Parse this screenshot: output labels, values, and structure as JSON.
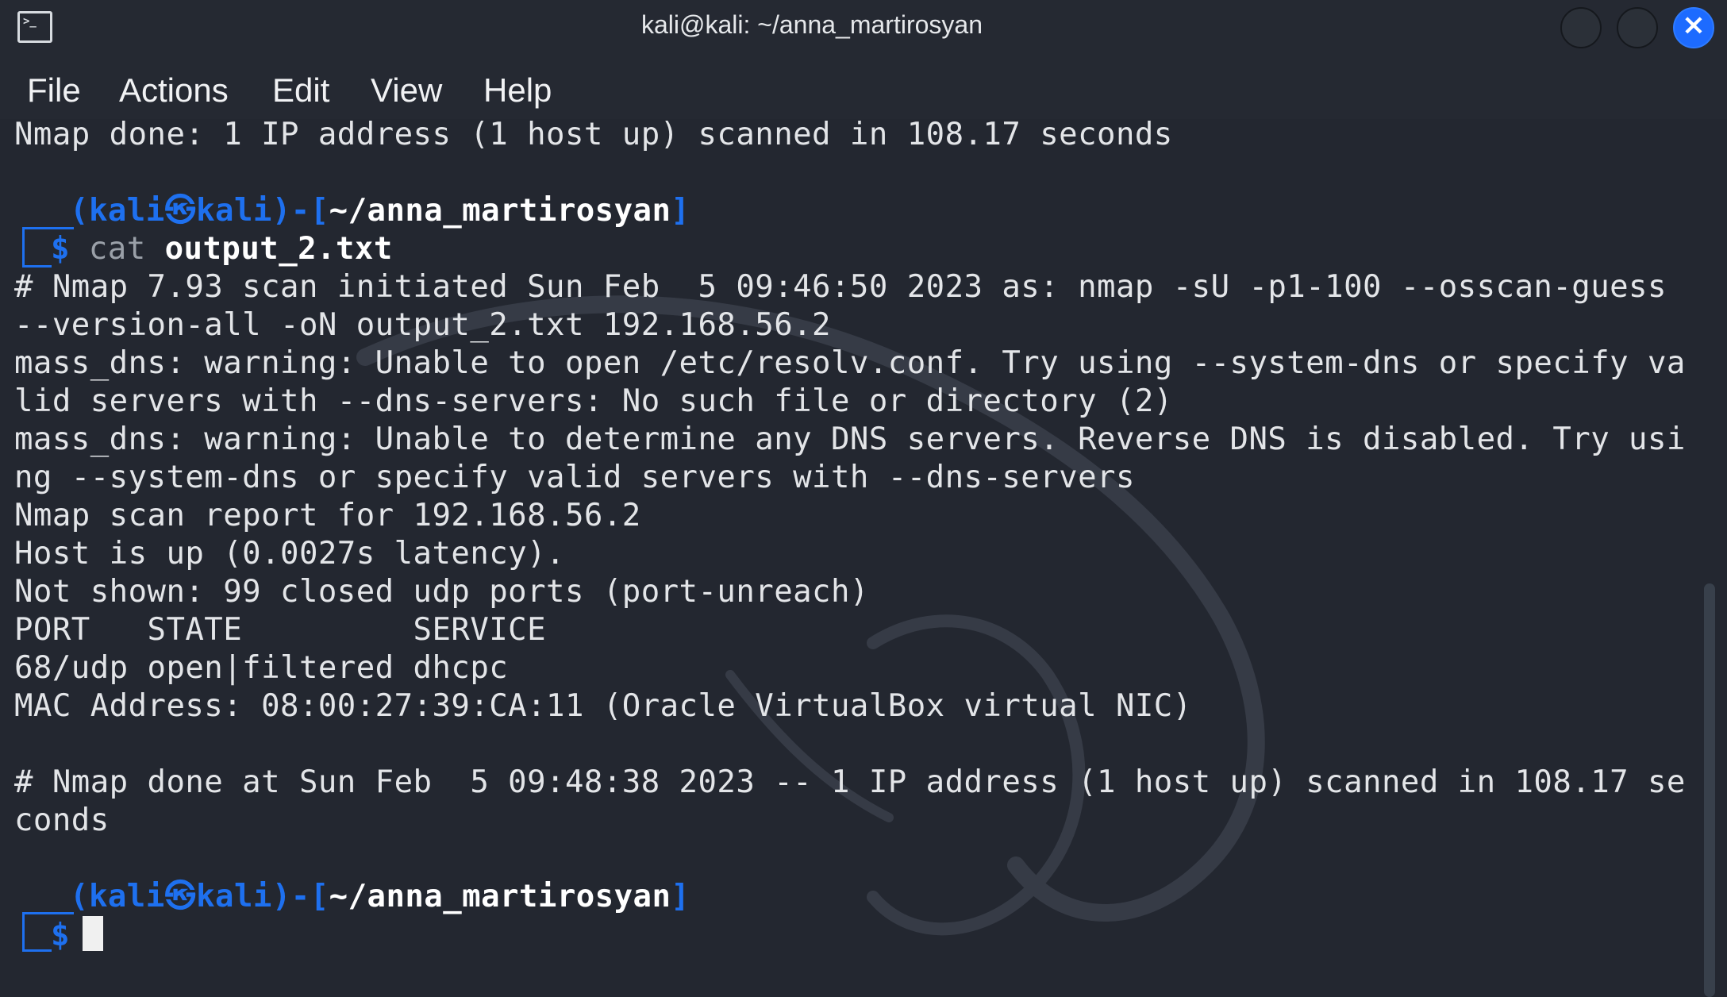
{
  "window": {
    "title": "kali@kali: ~/anna_martirosyan"
  },
  "menu": {
    "file": "File",
    "actions": "Actions",
    "edit": "Edit",
    "view": "View",
    "help": "Help"
  },
  "terminal": {
    "line_done": "Nmap done: 1 IP address (1 host up) scanned in 108.17 seconds",
    "prompt1": {
      "open": "(",
      "user": "kali",
      "at": "㉿",
      "host": "kali",
      "mid": ")-[",
      "path": "~/anna_martirosyan",
      "close": "]",
      "dollar": "$",
      "cmd": "cat",
      "arg": "output_2.txt"
    },
    "output": [
      "# Nmap 7.93 scan initiated Sun Feb  5 09:46:50 2023 as: nmap -sU -p1-100 --osscan-guess",
      "--version-all -oN output_2.txt 192.168.56.2",
      "mass_dns: warning: Unable to open /etc/resolv.conf. Try using --system-dns or specify va",
      "lid servers with --dns-servers: No such file or directory (2)",
      "mass_dns: warning: Unable to determine any DNS servers. Reverse DNS is disabled. Try usi",
      "ng --system-dns or specify valid servers with --dns-servers",
      "Nmap scan report for 192.168.56.2",
      "Host is up (0.0027s latency).",
      "Not shown: 99 closed udp ports (port-unreach)",
      "PORT   STATE         SERVICE",
      "68/udp open|filtered dhcpc",
      "MAC Address: 08:00:27:39:CA:11 (Oracle VirtualBox virtual NIC)",
      "",
      "# Nmap done at Sun Feb  5 09:48:38 2023 -- 1 IP address (1 host up) scanned in 108.17 se",
      "conds"
    ],
    "prompt2": {
      "open": "(",
      "user": "kali",
      "at": "㉿",
      "host": "kali",
      "mid": ")-[",
      "path": "~/anna_martirosyan",
      "close": "]",
      "dollar": "$"
    }
  },
  "colors": {
    "background": "#232730",
    "prompt_blue": "#1e70ef",
    "text": "#e3e5e8",
    "close_button": "#1d6bff"
  },
  "icons": {
    "app": "terminal-icon",
    "minimize": "minimize-button",
    "maximize": "maximize-button",
    "close": "close-icon",
    "watermark": "kali-dragon-watermark"
  }
}
